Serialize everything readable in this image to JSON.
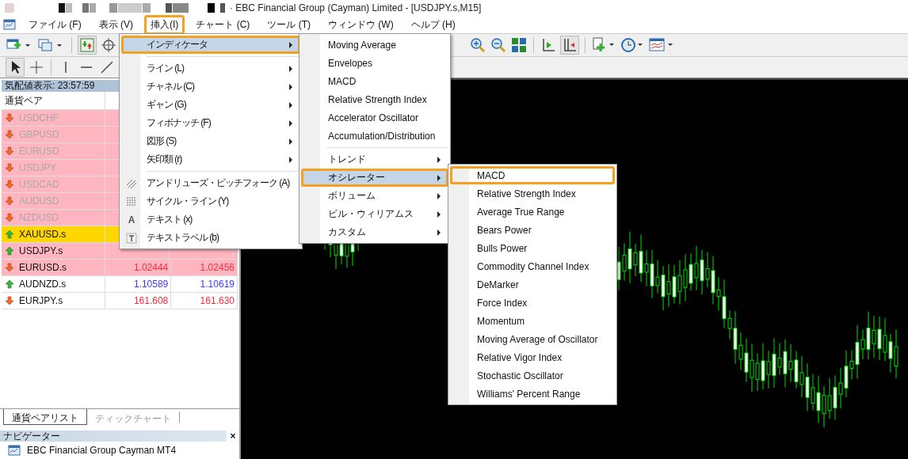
{
  "window": {
    "title": "· EBC Financial Group (Cayman) Limited - [USDJPY.s,M15]"
  },
  "menubar": [
    {
      "label": "ファイル (F)",
      "annotated": false
    },
    {
      "label": "表示 (V)",
      "annotated": false
    },
    {
      "label": "挿入(I)",
      "annotated": true
    },
    {
      "label": "チャート (C)",
      "annotated": false
    },
    {
      "label": "ツール (T)",
      "annotated": false
    },
    {
      "label": "ウィンドウ (W)",
      "annotated": false
    },
    {
      "label": "ヘルプ (H)",
      "annotated": false
    }
  ],
  "market_watch": {
    "title": "気配値表示: 23:57:59",
    "columns": [
      "通貨ペア"
    ],
    "rows": [
      {
        "symbol": "USDCHF",
        "rising": false,
        "disabled": true,
        "flash": true,
        "selected": false
      },
      {
        "symbol": "GBPUSD",
        "rising": false,
        "disabled": true,
        "flash": true,
        "selected": false
      },
      {
        "symbol": "EURUSD",
        "rising": false,
        "disabled": true,
        "flash": true,
        "selected": false
      },
      {
        "symbol": "USDJPY",
        "rising": false,
        "disabled": true,
        "flash": true,
        "selected": false
      },
      {
        "symbol": "USDCAD",
        "rising": false,
        "disabled": true,
        "flash": true,
        "selected": false
      },
      {
        "symbol": "AUDUSD",
        "rising": false,
        "disabled": true,
        "flash": true,
        "selected": false
      },
      {
        "symbol": "NZDUSD",
        "rising": false,
        "disabled": true,
        "flash": true,
        "selected": false
      },
      {
        "symbol": "XAUUSD.s",
        "rising": true,
        "disabled": false,
        "flash": false,
        "selected": true
      },
      {
        "symbol": "USDJPY.s",
        "rising": true,
        "disabled": false,
        "flash": true,
        "selected": false
      },
      {
        "symbol": "EURUSD.s",
        "rising": false,
        "disabled": false,
        "flash": true,
        "selected": false,
        "bid": "1.02444",
        "ask": "1.02456"
      },
      {
        "symbol": "AUDNZD.s",
        "rising": true,
        "disabled": false,
        "flash": false,
        "selected": false,
        "bid": "1.10589",
        "ask": "1.10619"
      },
      {
        "symbol": "EURJPY.s",
        "rising": false,
        "disabled": false,
        "flash": false,
        "selected": false,
        "bid": "161.608",
        "ask": "161.630"
      }
    ]
  },
  "tabs": [
    {
      "label": "通貨ペアリスト",
      "selected": true
    },
    {
      "label": "ティックチャート",
      "selected": false
    }
  ],
  "navigator": {
    "title": "ナビゲーター",
    "close": "×",
    "items": [
      {
        "label": "EBC Financial Group Cayman MT4"
      }
    ]
  },
  "insert_menu": {
    "items": [
      {
        "kind": "submenu",
        "label": "インディケータ",
        "selected": true,
        "annotated": true
      },
      {
        "kind": "separator"
      },
      {
        "kind": "submenu",
        "label": "ライン (L)",
        "selected": false,
        "annotated": false
      },
      {
        "kind": "submenu",
        "label": "チャネル (C)",
        "selected": false,
        "annotated": false
      },
      {
        "kind": "submenu",
        "label": "ギャン (G)",
        "selected": false,
        "annotated": false
      },
      {
        "kind": "submenu",
        "label": "フィボナッチ (F)",
        "selected": false,
        "annotated": false
      },
      {
        "kind": "submenu",
        "label": "図形 (S)",
        "selected": false,
        "annotated": false
      },
      {
        "kind": "submenu",
        "label": "矢印類 (r)",
        "selected": false,
        "annotated": false
      },
      {
        "kind": "separator"
      },
      {
        "kind": "tool",
        "label": "アンドリューズ・ピッチフォーク (A)",
        "selected": false,
        "annotated": false
      },
      {
        "kind": "tool",
        "label": "サイクル・ライン (Y)",
        "selected": false,
        "annotated": false
      },
      {
        "kind": "tool",
        "label": "テキスト (x)",
        "glyph": "A",
        "selected": false,
        "annotated": false
      },
      {
        "kind": "tool",
        "label": "テキストラベル (b)",
        "selected": false,
        "annotated": false
      }
    ]
  },
  "indicators_menu": {
    "items": [
      {
        "kind": "item",
        "label": "Moving Average",
        "selected": false,
        "annotated": false
      },
      {
        "kind": "item",
        "label": "Envelopes",
        "selected": false,
        "annotated": false
      },
      {
        "kind": "item",
        "label": "MACD",
        "selected": false,
        "annotated": false
      },
      {
        "kind": "item",
        "label": "Relative Strength Index",
        "selected": false,
        "annotated": false
      },
      {
        "kind": "item",
        "label": "Accelerator Oscillator",
        "selected": false,
        "annotated": false
      },
      {
        "kind": "item",
        "label": "Accumulation/Distribution",
        "selected": false,
        "annotated": false
      },
      {
        "kind": "separator"
      },
      {
        "kind": "submenu",
        "label": "トレンド",
        "selected": false,
        "annotated": false
      },
      {
        "kind": "submenu",
        "label": "オシレーター",
        "selected": true,
        "annotated": true
      },
      {
        "kind": "submenu",
        "label": "ボリューム",
        "selected": false,
        "annotated": false
      },
      {
        "kind": "submenu",
        "label": "ビル・ウィリアムス",
        "selected": false,
        "annotated": false
      },
      {
        "kind": "submenu",
        "label": "カスタム",
        "selected": false,
        "annotated": false
      }
    ]
  },
  "oscillators_menu": {
    "items": [
      {
        "kind": "item",
        "label": "MACD",
        "selected": false,
        "annotated": true
      },
      {
        "kind": "item",
        "label": "Relative Strength Index",
        "selected": false,
        "annotated": false
      },
      {
        "kind": "item",
        "label": "Average True Range",
        "selected": false,
        "annotated": false
      },
      {
        "kind": "item",
        "label": "Bears Power",
        "selected": false,
        "annotated": false
      },
      {
        "kind": "item",
        "label": "Bulls Power",
        "selected": false,
        "annotated": false
      },
      {
        "kind": "item",
        "label": "Commodity Channel Index",
        "selected": false,
        "annotated": false
      },
      {
        "kind": "item",
        "label": "DeMarker",
        "selected": false,
        "annotated": false
      },
      {
        "kind": "item",
        "label": "Force Index",
        "selected": false,
        "annotated": false
      },
      {
        "kind": "item",
        "label": "Momentum",
        "selected": false,
        "annotated": false
      },
      {
        "kind": "item",
        "label": "Moving Average of Oscillator",
        "selected": false,
        "annotated": false
      },
      {
        "kind": "item",
        "label": "Relative Vigor Index",
        "selected": false,
        "annotated": false
      },
      {
        "kind": "item",
        "label": "Stochastic Oscillator",
        "selected": false,
        "annotated": false
      },
      {
        "kind": "item",
        "label": "Williams' Percent Range",
        "selected": false,
        "annotated": false
      }
    ]
  }
}
